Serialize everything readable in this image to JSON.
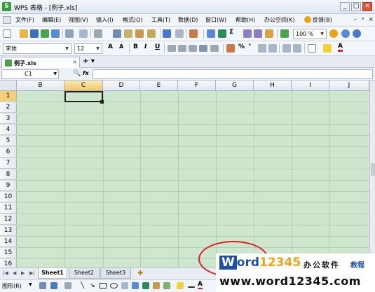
{
  "window": {
    "title": "WPS 表格 - [例子.xls]",
    "app_icon": "S",
    "controls": [
      "_",
      "□",
      "✕"
    ]
  },
  "menubar": {
    "items": [
      "文件(F)",
      "编辑(E)",
      "视图(V)",
      "插入(I)",
      "格式(O)",
      "工具(T)",
      "数据(D)",
      "窗口(W)",
      "帮助(H)",
      "办公空间(K)",
      "反馈(B)"
    ]
  },
  "standard_toolbar": {
    "zoom": "100 %"
  },
  "format_toolbar": {
    "font_name": "宋体",
    "font_size": "12",
    "bold": "B",
    "italic": "I",
    "underline": "U",
    "percent": "%",
    "comma": "❜"
  },
  "document_tabs": [
    {
      "label": "例子.xls",
      "active": true
    }
  ],
  "formula_bar": {
    "name_box": "C1",
    "fx": "fx",
    "value": ""
  },
  "grid": {
    "columns": [
      "B",
      "C",
      "D",
      "E",
      "F",
      "G",
      "H",
      "I",
      "J"
    ],
    "active_column": "C",
    "rows": [
      "1",
      "2",
      "3",
      "4",
      "5",
      "6",
      "7",
      "8",
      "9",
      "10",
      "11",
      "12",
      "13",
      "14",
      "15",
      "16"
    ],
    "active_row": "1",
    "active_cell": "C1",
    "background": "#cde6cd"
  },
  "sheets": {
    "tabs": [
      "Sheet1",
      "Sheet2",
      "Sheet3"
    ],
    "active": "Sheet1",
    "add": "✚"
  },
  "drawing_toolbar": {
    "label": "图形(R)"
  },
  "watermark": {
    "logo_w": "W",
    "logo_ord": "ord",
    "logo_num": "12345",
    "cn_text": "办公软件",
    "cn_text2": "教程",
    "url": "www.word12345.com",
    "colors": {
      "blue": "#1e4fa6",
      "orange": "#e8a317",
      "red": "#d9202b"
    }
  }
}
